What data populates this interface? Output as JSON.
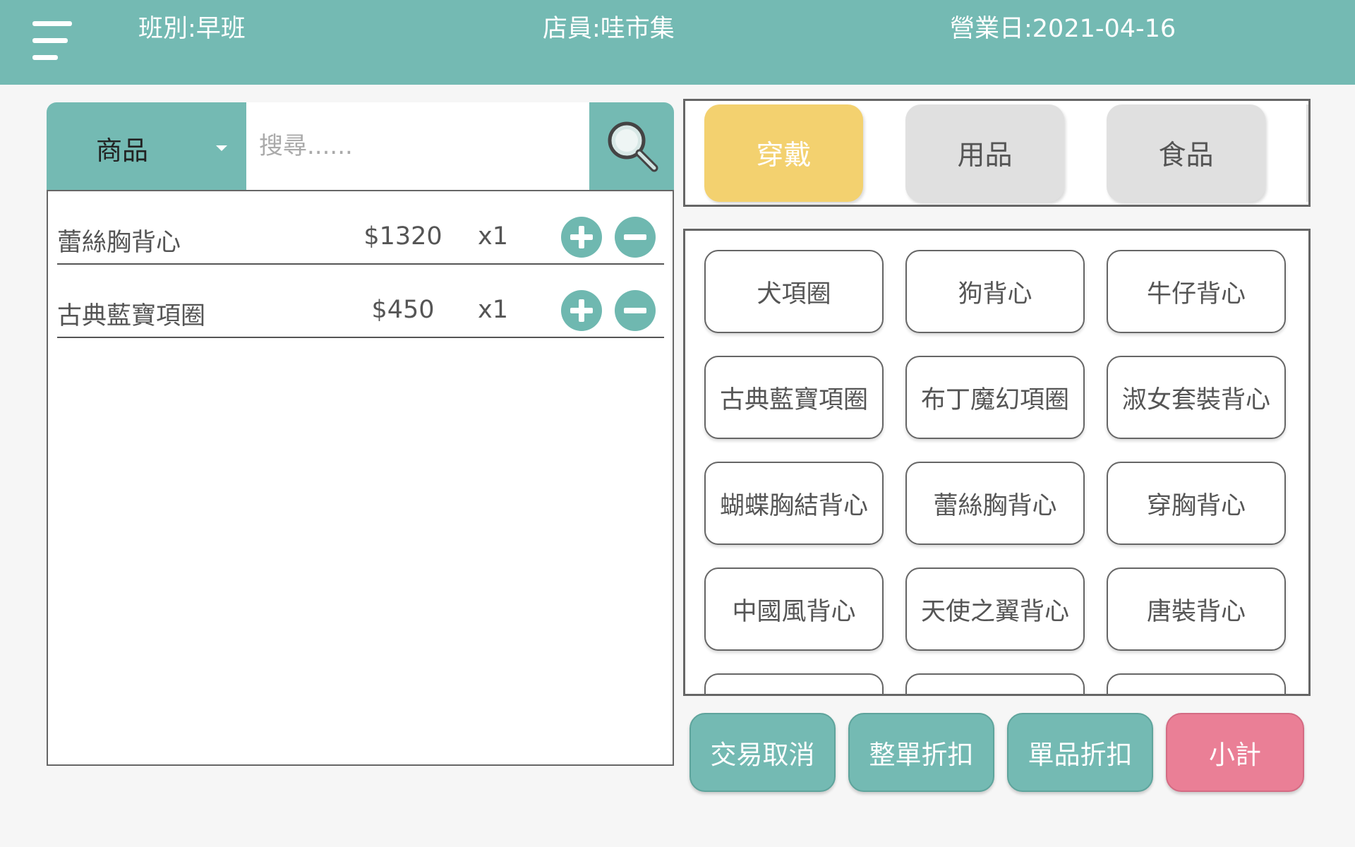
{
  "header": {
    "menu_icon": "hamburger-menu-icon",
    "shift": "班別:早班",
    "staff": "店員:哇市集",
    "business_date": "營業日:2021-04-16"
  },
  "search": {
    "category_selected": "商品",
    "placeholder": "搜尋......",
    "value": "",
    "search_icon": "magnifier-icon"
  },
  "cart": {
    "items": [
      {
        "name": "蕾絲胸背心",
        "price": "$1320",
        "qty": "x1"
      },
      {
        "name": "古典藍寶項圈",
        "price": "$450",
        "qty": "x1"
      }
    ]
  },
  "category_tabs": [
    {
      "label": "穿戴",
      "active": true
    },
    {
      "label": "用品",
      "active": false
    },
    {
      "label": "食品",
      "active": false
    }
  ],
  "products": [
    "犬項圈",
    "狗背心",
    "牛仔背心",
    "古典藍寶項圈",
    "布丁魔幻項圈",
    "淑女套裝背心",
    "蝴蝶胸結背心",
    "蕾絲胸背心",
    "穿胸背心",
    "中國風背心",
    "天使之翼背心",
    "唐裝背心"
  ],
  "actions": {
    "cancel": "交易取消",
    "order_discount": "整單折扣",
    "item_discount": "單品折扣",
    "subtotal": "小計"
  },
  "colors": {
    "primary": "#74bab3",
    "active_tab": "#f3d16f",
    "subtotal": "#ea7f96"
  }
}
